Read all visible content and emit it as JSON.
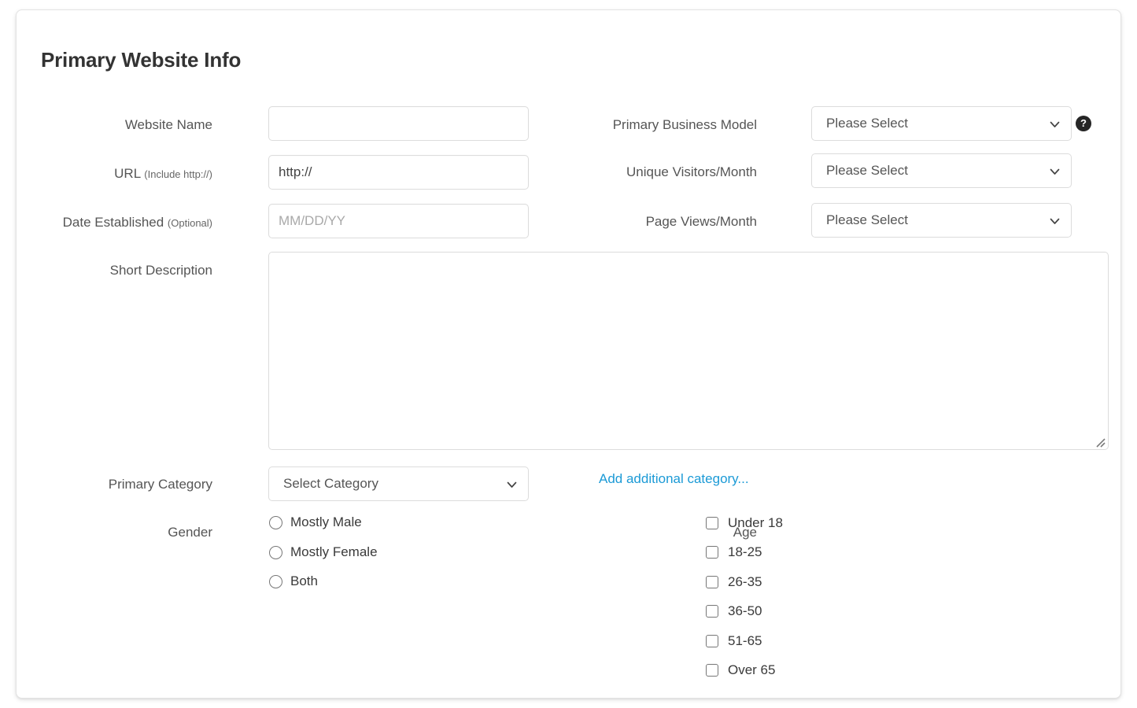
{
  "card": {
    "title": "Primary Website Info"
  },
  "left_fields": {
    "website_name": {
      "label": "Website Name",
      "value": "",
      "placeholder": ""
    },
    "url": {
      "label": "URL",
      "label_sub": "(Include http://)",
      "value": "http://",
      "placeholder": ""
    },
    "date_established": {
      "label": "Date Established",
      "label_sub": "(Optional)",
      "value": "",
      "placeholder": "MM/DD/YY"
    },
    "short_description": {
      "label": "Short Description",
      "value": "",
      "placeholder": ""
    },
    "primary_category": {
      "label": "Primary Category",
      "selected": "Select Category"
    }
  },
  "right_fields": {
    "primary_business_model": {
      "label": "Primary Business Model",
      "selected": "Please Select",
      "help_icon": "question-mark-icon",
      "help_glyph": "?"
    },
    "unique_visitors": {
      "label": "Unique Visitors/Month",
      "selected": "Please Select"
    },
    "page_views": {
      "label": "Page Views/Month",
      "selected": "Please Select"
    }
  },
  "add_category_link": {
    "label": "Add additional category..."
  },
  "gender": {
    "label": "Gender",
    "options": [
      {
        "label": "Mostly Male",
        "checked": false
      },
      {
        "label": "Mostly Female",
        "checked": false
      },
      {
        "label": "Both",
        "checked": false
      }
    ]
  },
  "age": {
    "label": "Age",
    "options": [
      {
        "label": "Under 18",
        "checked": false
      },
      {
        "label": "18-25",
        "checked": false
      },
      {
        "label": "26-35",
        "checked": false
      },
      {
        "label": "36-50",
        "checked": false
      },
      {
        "label": "51-65",
        "checked": false
      },
      {
        "label": "Over 65",
        "checked": false
      }
    ]
  },
  "colors": {
    "link": "#1b9ad6",
    "border": "#dcdcdc",
    "title": "#333333",
    "label": "#555555",
    "help_bg": "#262626"
  }
}
